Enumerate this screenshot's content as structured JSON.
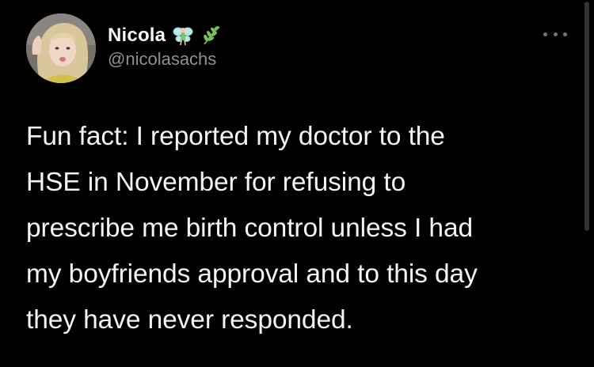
{
  "tweet": {
    "author": {
      "display_name": "Nicola",
      "handle": "@nicolasachs",
      "name_emojis": [
        "fairy-emoji",
        "herb-emoji"
      ]
    },
    "text": "Fun fact: I reported my doctor to the\nHSE in November for refusing to\nprescribe me birth control unless I had\nmy boyfriends approval and to this day\nthey have never responded."
  },
  "colors": {
    "background": "#000000",
    "name": "#f7f9f9",
    "handle": "#8b9298",
    "body": "#f2f4f5"
  },
  "icons": {
    "more": "more-horizontal-icon"
  }
}
